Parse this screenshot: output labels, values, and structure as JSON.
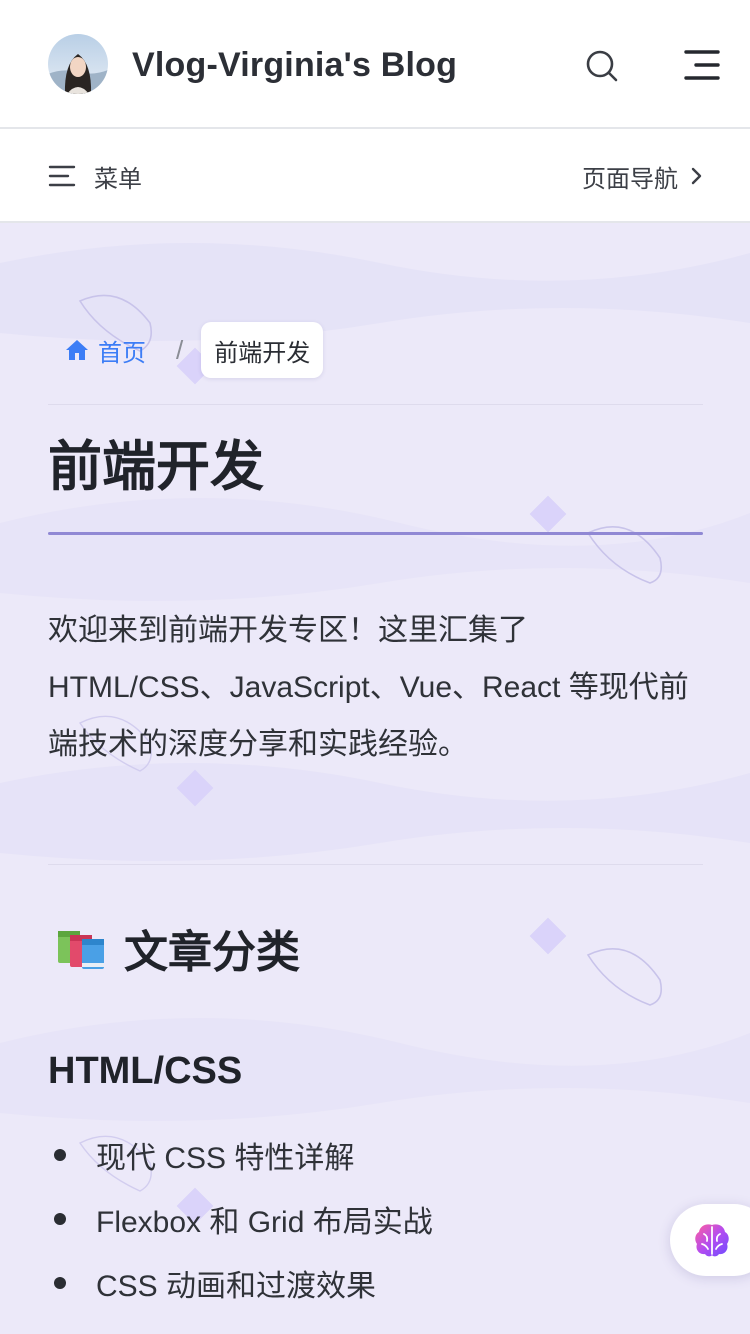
{
  "navbar": {
    "title": "Vlog-Virginia's Blog",
    "search_icon": "search-icon",
    "menu_icon": "menu-icon"
  },
  "localnav": {
    "menu_label": "菜单",
    "outline_label": "页面导航"
  },
  "breadcrumb": {
    "home_label": "首页",
    "separator": "/",
    "current_label": "前端开发"
  },
  "page": {
    "title": "前端开发",
    "intro": "欢迎来到前端开发专区！这里汇集了 HTML/CSS、JavaScript、Vue、React 等现代前端技术的深度分享和实践经验。",
    "section_icon": "books-icon",
    "section_title": "文章分类",
    "subsection_title": "HTML/CSS",
    "items": [
      "现代 CSS 特性详解",
      "Flexbox 和 Grid 布局实战",
      "CSS 动画和过渡效果"
    ]
  },
  "colors": {
    "accent": "#3c7df6",
    "title_underline": "#9088d4",
    "content_bg": "#ece9f9"
  },
  "floating_button_icon": "ai-brain-icon"
}
